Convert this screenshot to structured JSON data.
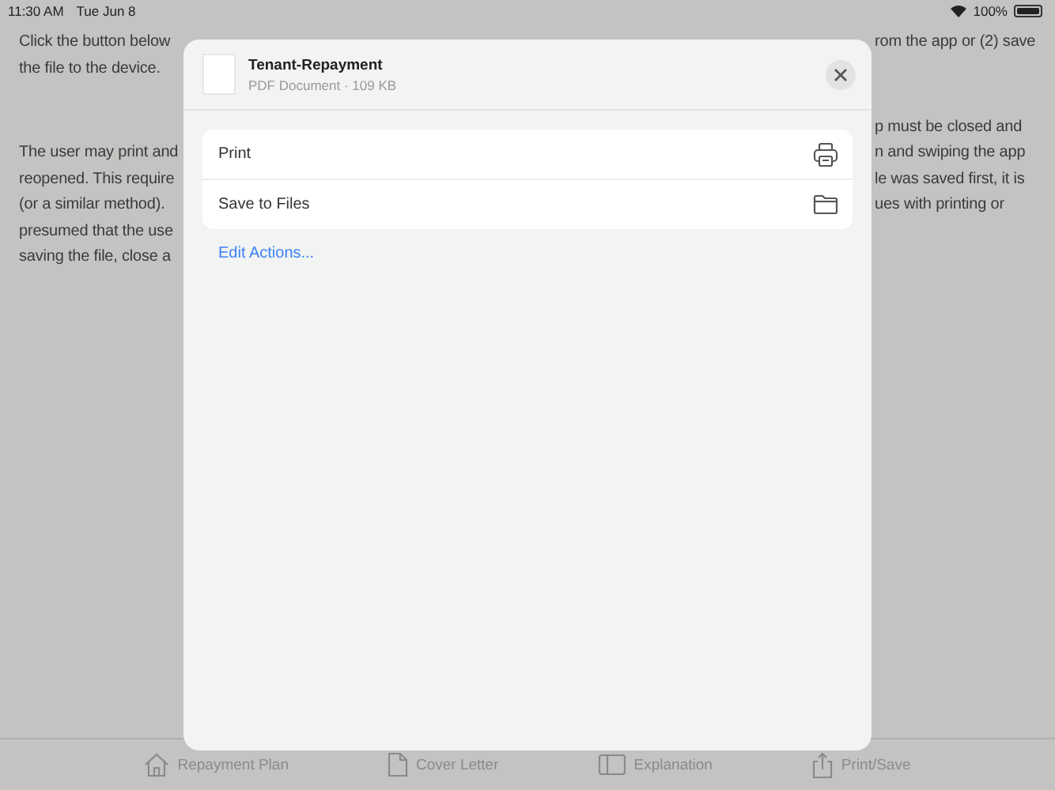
{
  "status_bar": {
    "time": "11:30 AM",
    "date": "Tue Jun 8",
    "battery": "100%"
  },
  "background_left": [
    [
      "Click the button below",
      "the file to the device."
    ],
    [
      "The user may print and",
      "reopened. This require",
      "(or a similar method).",
      "presumed that the use",
      "saving the file, close a"
    ]
  ],
  "background_right": [
    [
      "rom the app or (2) save"
    ],
    [
      "p must be closed and",
      "n and swiping the app",
      "le was saved first, it is",
      "ues with printing or"
    ]
  ],
  "share_sheet": {
    "title": "Tenant-Repayment",
    "subtitle": "PDF Document · 109 KB",
    "actions": [
      {
        "label": "Print",
        "kind": "print"
      },
      {
        "label": "Save to Files",
        "kind": "folder"
      }
    ],
    "edit_link": "Edit Actions..."
  },
  "tab_bar": [
    {
      "label": "Repayment Plan",
      "kind": "house"
    },
    {
      "label": "Cover Letter",
      "kind": "document"
    },
    {
      "label": "Explanation",
      "kind": "sidebar"
    },
    {
      "label": "Print/Save",
      "kind": "share"
    }
  ]
}
